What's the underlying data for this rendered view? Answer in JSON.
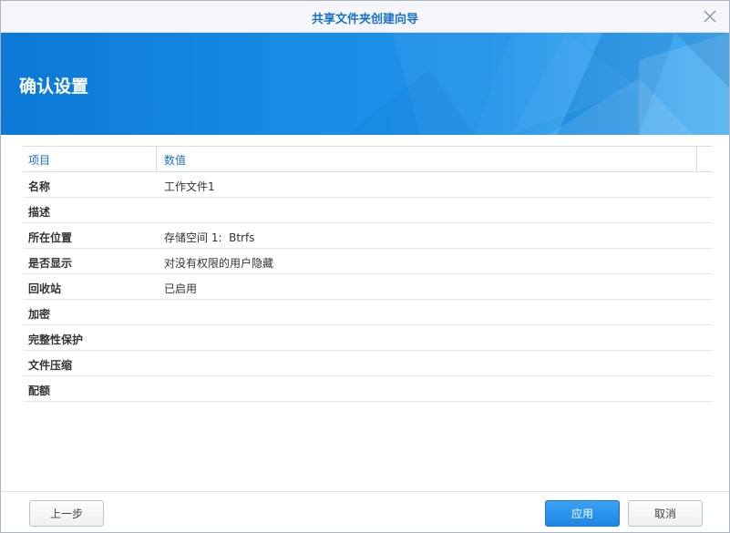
{
  "window": {
    "title": "共享文件夹创建向导"
  },
  "banner": {
    "heading": "确认设置"
  },
  "table": {
    "headers": {
      "item": "项目",
      "value": "数值"
    },
    "rows": [
      {
        "key": "名称",
        "value": "工作文件1"
      },
      {
        "key": "描述",
        "value": ""
      },
      {
        "key": "所在位置",
        "value": "存储空间 1:  Btrfs"
      },
      {
        "key": "是否显示",
        "value": "对没有权限的用户隐藏"
      },
      {
        "key": "回收站",
        "value": "已启用"
      },
      {
        "key": "加密",
        "value": ""
      },
      {
        "key": "完整性保护",
        "value": ""
      },
      {
        "key": "文件压缩",
        "value": ""
      },
      {
        "key": "配额",
        "value": ""
      }
    ]
  },
  "footer": {
    "prev_label": "上一步",
    "apply_label": "应用",
    "cancel_label": "取消"
  },
  "colors": {
    "accent": "#1a70c9",
    "banner": "#1a8de6",
    "primary_button": "#2495ec"
  },
  "icons": {
    "close": "close-icon"
  }
}
